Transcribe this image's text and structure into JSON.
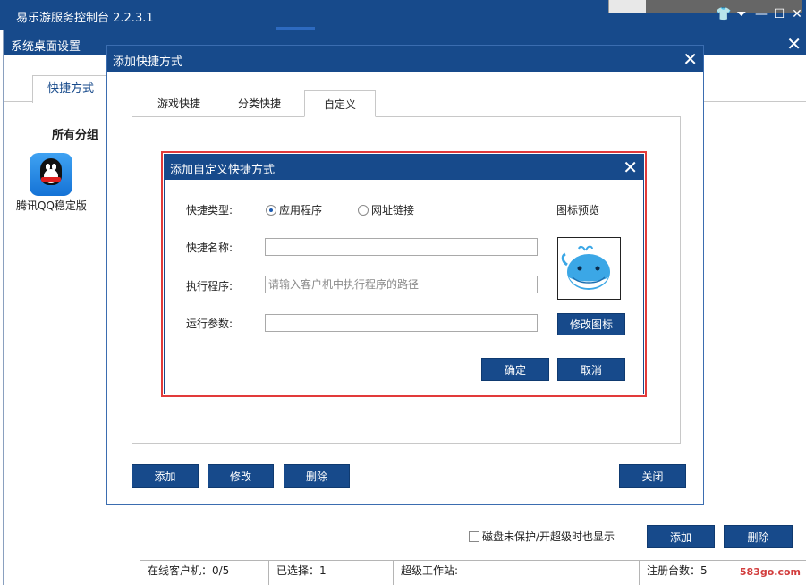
{
  "app": {
    "title": "易乐游服务控制台 2.2.3.1"
  },
  "settings_window": {
    "title": "系统桌面设置",
    "tab_label": "快捷方式",
    "group_title": "所有分组",
    "shortcuts": [
      {
        "label": "腾讯QQ稳定版",
        "icon": "qq-penguin-icon"
      }
    ],
    "checkbox_label": "磁盘未保护/开超级时也显示",
    "add_button": "添加",
    "delete_button": "删除"
  },
  "status_bar": {
    "online_clients": "在线客户机：0/5",
    "selected": "已选择：1",
    "super_workstation": "超级工作站:",
    "registered": "注册台数：5",
    "watermark": "583go.com"
  },
  "add_dialog": {
    "title": "添加快捷方式",
    "tabs": [
      "游戏快捷",
      "分类快捷",
      "自定义"
    ],
    "active_tab": 2,
    "buttons": {
      "add": "添加",
      "edit": "修改",
      "delete": "删除",
      "close": "关闭"
    }
  },
  "custom_dialog": {
    "title": "添加自定义快捷方式",
    "type_label": "快捷类型:",
    "radio_app": "应用程序",
    "radio_url": "网址链接",
    "selected_type": "应用程序",
    "icon_preview_label": "图标预览",
    "name_label": "快捷名称:",
    "name_value": "",
    "program_label": "执行程序:",
    "program_placeholder": "请输入客户机中执行程序的路径",
    "program_value": "",
    "args_label": "运行参数:",
    "args_value": "",
    "change_icon_button": "修改图标",
    "ok_button": "确定",
    "cancel_button": "取消"
  },
  "colors": {
    "titlebar": "#174a8b",
    "highlight_outline": "#e23a3a"
  }
}
